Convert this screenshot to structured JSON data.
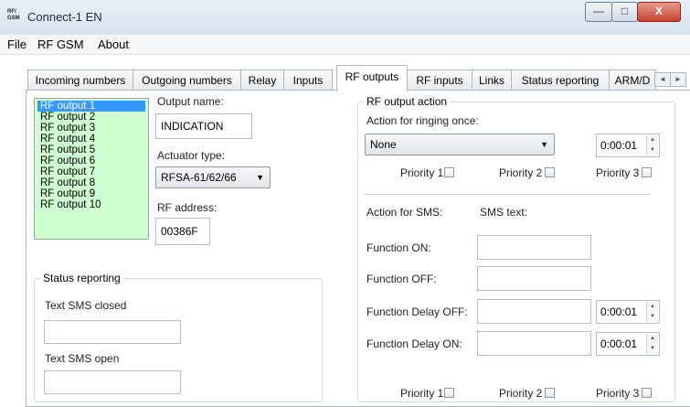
{
  "window": {
    "title": "Connect-1 EN",
    "icon_text_line1": "RF/",
    "icon_text_line2": "GSM",
    "minimize": "—",
    "maximize": "□",
    "close": "X"
  },
  "menu": [
    "File",
    "RF GSM",
    "About"
  ],
  "tabs": [
    "Incoming numbers",
    "Outgoing numbers",
    "Relay",
    "Inputs",
    "RF outputs",
    "RF inputs",
    "Links",
    "Status reporting",
    "ARM/D"
  ],
  "tab_scroll": {
    "left": "◄",
    "right": "►"
  },
  "outputs": [
    "RF output 1",
    "RF output 2",
    "RF output 3",
    "RF output 4",
    "RF output 5",
    "RF output 6",
    "RF output 7",
    "RF output 8",
    "RF output 9",
    "RF output 10"
  ],
  "output_name": {
    "label": "Output name:",
    "value": "INDICATION"
  },
  "actuator": {
    "label": "Actuator type:",
    "value": "RFSA-61/62/66"
  },
  "rf_address": {
    "label": "RF address:",
    "value": "00386F"
  },
  "status_reporting": {
    "title": "Status reporting",
    "closed_label": "Text SMS closed",
    "closed_value": "",
    "open_label": "Text SMS open",
    "open_value": ""
  },
  "rf_action": {
    "title": "RF output action",
    "ringing_label": "Action for ringing once:",
    "ringing_value": "None",
    "ringing_time": "0:00:01",
    "priority_1": "Priority 1",
    "priority_2": "Priority 2",
    "priority_3": "Priority 3",
    "sms_label": "Action for SMS:",
    "sms_text_label": "SMS text:",
    "func_on": "Function ON:",
    "func_off": "Function OFF:",
    "func_delay_off": "Function Delay OFF:",
    "func_delay_off_time": "0:00:01",
    "func_delay_on": "Function Delay ON:",
    "func_delay_on_time": "0:00:01"
  },
  "icons": {
    "dropdown": "▼",
    "spin_up": "▲",
    "spin_down": "▼"
  }
}
